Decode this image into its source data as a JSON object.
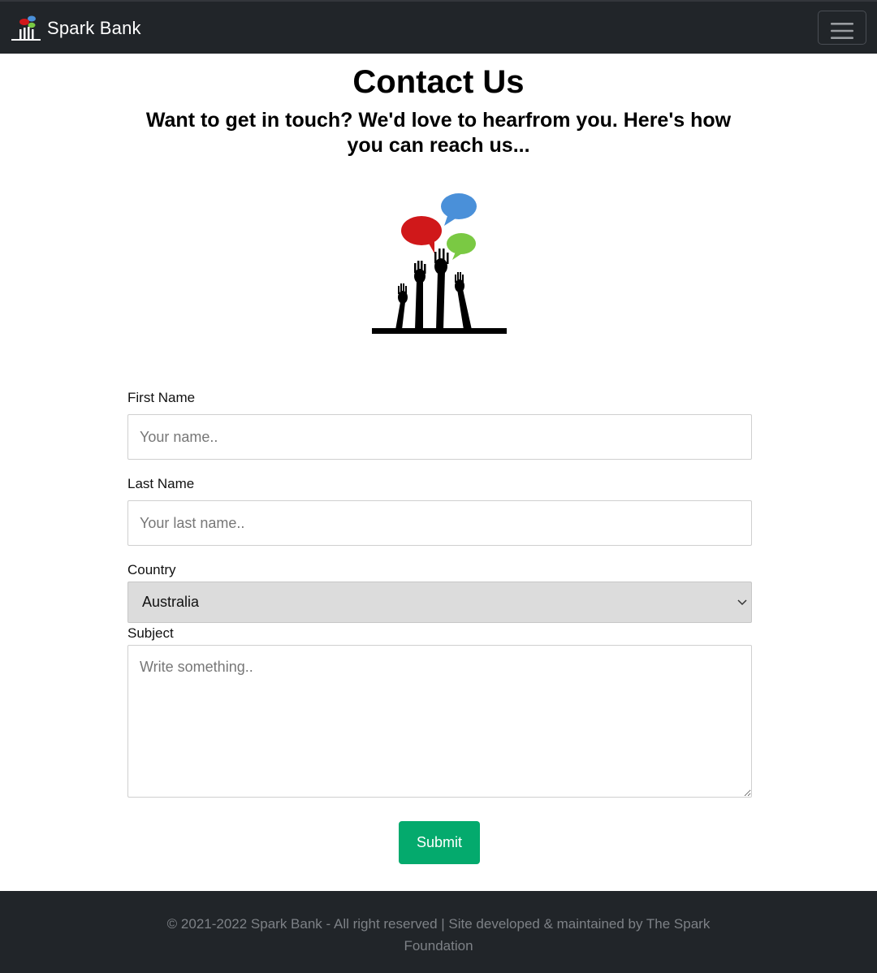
{
  "navbar": {
    "brand": "Spark Bank",
    "brand_logo_icon": "hands-speech-bubbles-logo",
    "toggler_icon": "hamburger-menu-icon",
    "background": "#212529"
  },
  "header": {
    "title": "Contact Us",
    "subtitle": "Want to get in touch? We'd love to hearfrom you. Here's how you can reach us...",
    "hero_icon": "raised-hands-speech-bubbles"
  },
  "form": {
    "first_name": {
      "label": "First Name",
      "placeholder": "Your name.."
    },
    "last_name": {
      "label": "Last Name",
      "placeholder": "Your last name.."
    },
    "country": {
      "label": "Country",
      "selected": "Australia"
    },
    "subject": {
      "label": "Subject",
      "placeholder": "Write something.."
    },
    "submit_label": "Submit",
    "submit_color": "#04aa6d"
  },
  "footer": {
    "text": "© 2021-2022 Spark Bank - All right reserved | Site developed & maintained by The Spark Foundation",
    "background": "#212529"
  }
}
